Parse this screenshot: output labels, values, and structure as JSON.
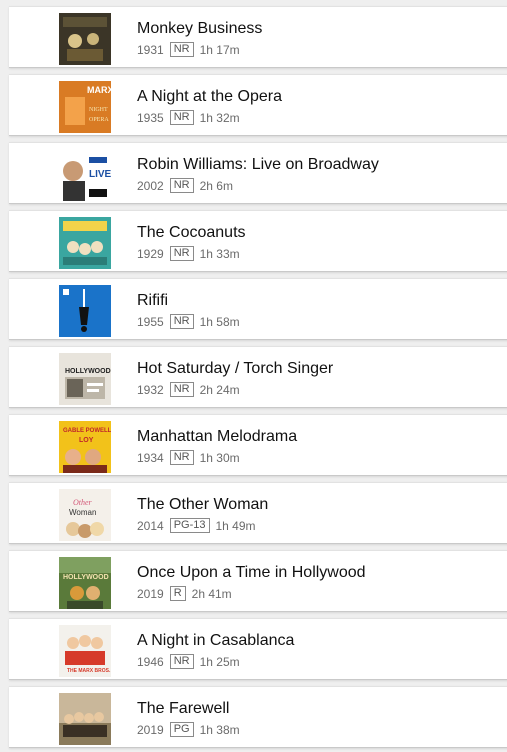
{
  "items": [
    {
      "title": "Monkey Business",
      "year": "1931",
      "rating": "NR",
      "runtime": "1h 17m",
      "poster": {
        "bg": "#3b3527",
        "accent": "#d9c48a",
        "icon": "monkey-business-poster"
      }
    },
    {
      "title": "A Night at the Opera",
      "year": "1935",
      "rating": "NR",
      "runtime": "1h 32m",
      "poster": {
        "bg": "#d97b24",
        "accent": "#f7e6b0",
        "icon": "night-at-the-opera-poster",
        "text": "MARX"
      }
    },
    {
      "title": "Robin Williams: Live on Broadway",
      "year": "2002",
      "rating": "NR",
      "runtime": "2h 6m",
      "poster": {
        "bg": "#ffffff",
        "accent": "#1b4fa3",
        "icon": "robin-williams-poster",
        "text": "LIVE"
      }
    },
    {
      "title": "The Cocoanuts",
      "year": "1929",
      "rating": "NR",
      "runtime": "1h 33m",
      "poster": {
        "bg": "#3aa6a0",
        "accent": "#f2d34a",
        "icon": "cocoanuts-poster"
      }
    },
    {
      "title": "Rififi",
      "year": "1955",
      "rating": "NR",
      "runtime": "1h 58m",
      "poster": {
        "bg": "#1a73c9",
        "accent": "#111111",
        "icon": "rififi-poster"
      }
    },
    {
      "title": "Hot Saturday / Torch Singer",
      "year": "1932",
      "rating": "NR",
      "runtime": "2h 24m",
      "poster": {
        "bg": "#e8e4dc",
        "accent": "#222222",
        "icon": "hollywood-poster",
        "text": "HOLLYWOOD"
      }
    },
    {
      "title": "Manhattan Melodrama",
      "year": "1934",
      "rating": "NR",
      "runtime": "1h 30m",
      "poster": {
        "bg": "#f2c21a",
        "accent": "#c0262b",
        "icon": "manhattan-melodrama-poster",
        "text": "GABLE POWELL LOY"
      }
    },
    {
      "title": "The Other Woman",
      "year": "2014",
      "rating": "PG-13",
      "runtime": "1h 49m",
      "poster": {
        "bg": "#f4f0ea",
        "accent": "#d45a7a",
        "icon": "other-woman-poster",
        "text": "Other Woman"
      }
    },
    {
      "title": "Once Upon a Time in Hollywood",
      "year": "2019",
      "rating": "R",
      "runtime": "2h 41m",
      "poster": {
        "bg": "#5a7a3a",
        "accent": "#d99a3a",
        "icon": "once-upon-a-time-poster",
        "text": "HOLLYWOOD"
      }
    },
    {
      "title": "A Night in Casablanca",
      "year": "1946",
      "rating": "NR",
      "runtime": "1h 25m",
      "poster": {
        "bg": "#f3f1ec",
        "accent": "#d63a2a",
        "icon": "night-in-casablanca-poster",
        "text": "THE MARX BROS."
      }
    },
    {
      "title": "The Farewell",
      "year": "2019",
      "rating": "PG",
      "runtime": "1h 38m",
      "poster": {
        "bg": "#c9b79a",
        "accent": "#3a3024",
        "icon": "farewell-poster"
      }
    }
  ]
}
